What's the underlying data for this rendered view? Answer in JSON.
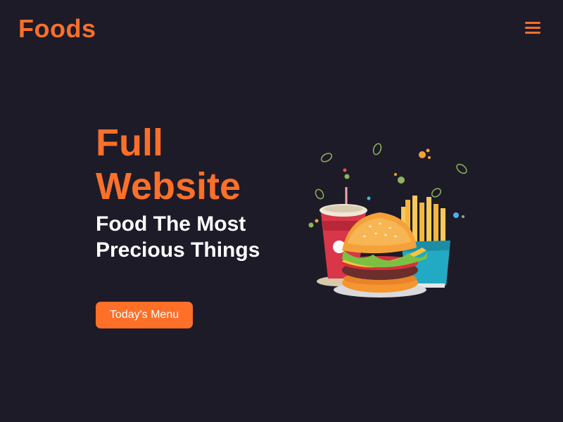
{
  "header": {
    "logo": "Foods",
    "menu_icon": "hamburger-menu-icon"
  },
  "hero": {
    "title": "Full Website",
    "subtitle": "Food The Most Precious Things",
    "cta_label": "Today's Menu"
  },
  "illustration": {
    "icon": "fast-food-illustration"
  },
  "colors": {
    "background": "#1d1b28",
    "accent": "#fe6f28",
    "text": "#ffffff"
  }
}
